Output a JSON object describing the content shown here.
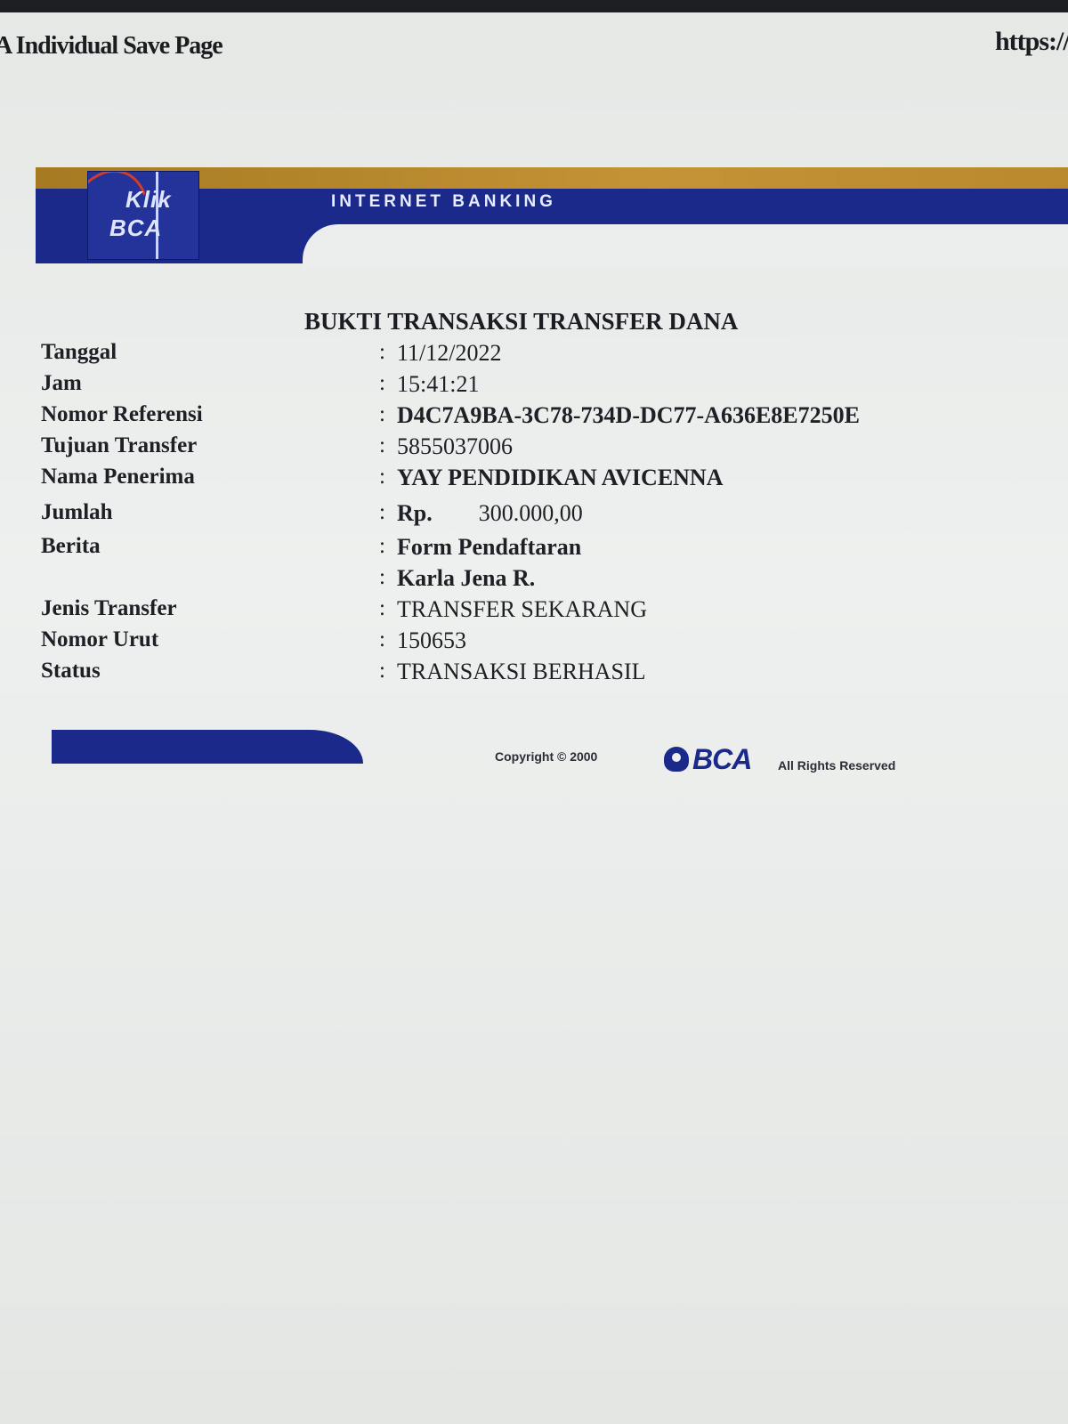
{
  "print_header": {
    "title": "A Individual Save Page",
    "url": "https://"
  },
  "banner": {
    "logo_top": "Klik",
    "logo_bottom": "BCA",
    "text": "INTERNET BANKING",
    "colors": {
      "navy": "#1b2a8a",
      "gold": "#c49336",
      "logo_swoosh": "#d33a2c"
    }
  },
  "receipt": {
    "title": "BUKTI TRANSAKSI TRANSFER DANA",
    "fields": [
      {
        "label": "Tanggal",
        "value": "11/12/2022"
      },
      {
        "label": "Jam",
        "value": "15:41:21"
      },
      {
        "label": "Nomor Referensi",
        "value": "D4C7A9BA-3C78-734D-DC77-A636E8E7250E"
      },
      {
        "label": "Tujuan Transfer",
        "value": "5855037006"
      },
      {
        "label": "Nama Penerima",
        "value": "YAY PENDIDIKAN AVICENNA"
      },
      {
        "label": "Jumlah",
        "currency": "Rp.",
        "value": "300.000,00"
      },
      {
        "label": "Berita",
        "value": "Form Pendaftaran"
      },
      {
        "label": "",
        "value": "Karla Jena R."
      },
      {
        "label": "Jenis Transfer",
        "value": "TRANSFER SEKARANG"
      },
      {
        "label": "Nomor Urut",
        "value": "150653"
      },
      {
        "label": "Status",
        "value": "TRANSAKSI BERHASIL"
      }
    ]
  },
  "footer": {
    "copyright": "Copyright © 2000",
    "logo": "BCA",
    "rights": "All Rights Reserved"
  }
}
